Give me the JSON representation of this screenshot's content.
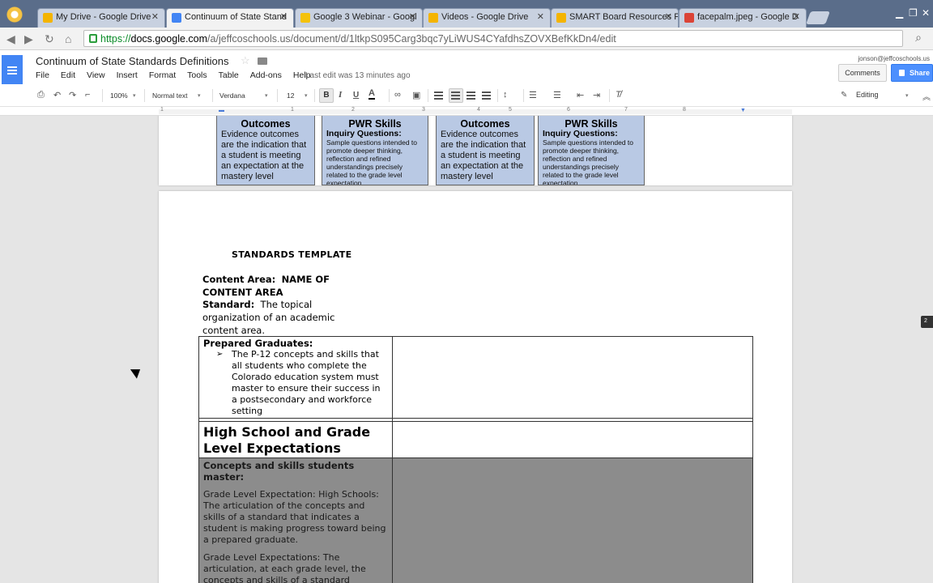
{
  "browser": {
    "tabs": [
      {
        "label": "My Drive - Google Drive",
        "icon_color": "#f4b400"
      },
      {
        "label": "Continuum of State Stand",
        "icon_color": "#4285f4"
      },
      {
        "label": "Google 3 Webinar - Googl",
        "icon_color": "#f4c20d"
      },
      {
        "label": "Videos - Google Drive",
        "icon_color": "#f4b400"
      },
      {
        "label": "SMART Board Resources F",
        "icon_color": "#f4b400"
      },
      {
        "label": "facepalm.jpeg - Google D",
        "icon_color": "#db4437"
      }
    ],
    "url": {
      "scheme": "https://",
      "host": "docs.google.com",
      "rest": "/a/jeffcoschools.us/document/d/1ltkpS095Carg3bqc7yLiWUS4CYafdhsZOVXBefKkDn4/edit"
    }
  },
  "docs": {
    "title": "Continuum of State Standards Definitions",
    "menu": [
      "File",
      "Edit",
      "View",
      "Insert",
      "Format",
      "Tools",
      "Table",
      "Add-ons",
      "Help"
    ],
    "last_edit": "Last edit was 13 minutes ago",
    "user_email": "jonson@jeffcoschools.us",
    "comments_label": "Comments",
    "share_label": "Share",
    "toolbar": {
      "zoom": "100%",
      "style": "Normal text",
      "font": "Verdana",
      "size": "12",
      "mode": "Editing"
    },
    "ruler_numbers": [
      "1",
      "1",
      "2",
      "3",
      "4",
      "5",
      "6",
      "7",
      "8"
    ]
  },
  "page1": {
    "cells": [
      {
        "heading": "Outcomes",
        "body": "Evidence outcomes are the indication that a student is meeting an expectation at the mastery level"
      },
      {
        "heading": "PWR Skills",
        "sub": "Inquiry Questions:",
        "body": "Sample questions intended to promote deeper thinking, reflection and refined understandings precisely related to the grade level expectation"
      },
      {
        "heading": "Outcomes",
        "body": "Evidence outcomes are the indication that a student is meeting an expectation at the mastery level"
      },
      {
        "heading": "PWR Skills",
        "sub": "Inquiry Questions:",
        "body": "Sample questions intended to promote deeper thinking, reflection and refined understandings precisely related to the grade level expectation"
      }
    ]
  },
  "page2": {
    "template_title": "STANDARDS TEMPLATE",
    "content_area_label": "Content Area:",
    "content_area_value": "NAME OF CONTENT AREA",
    "standard_label": "Standard:",
    "standard_value": "The topical organization of an academic content area.",
    "prepared_title": "Prepared Graduates:",
    "prepared_item": "The P-12 concepts and skills that all students who complete the Colorado education system must master to ensure their success in a postsecondary and workforce setting",
    "hs_title": "High School and Grade Level Expectations",
    "concepts_title": "Concepts and skills students master:",
    "gle_1": "Grade Level Expectation: High Schools: The articulation of the concepts and skills of a standard that indicates a student is making progress toward being a prepared graduate.",
    "gle_2": "Grade Level Expectations: The articulation, at each grade level, the concepts and skills of a standard"
  },
  "side_badge": "2"
}
